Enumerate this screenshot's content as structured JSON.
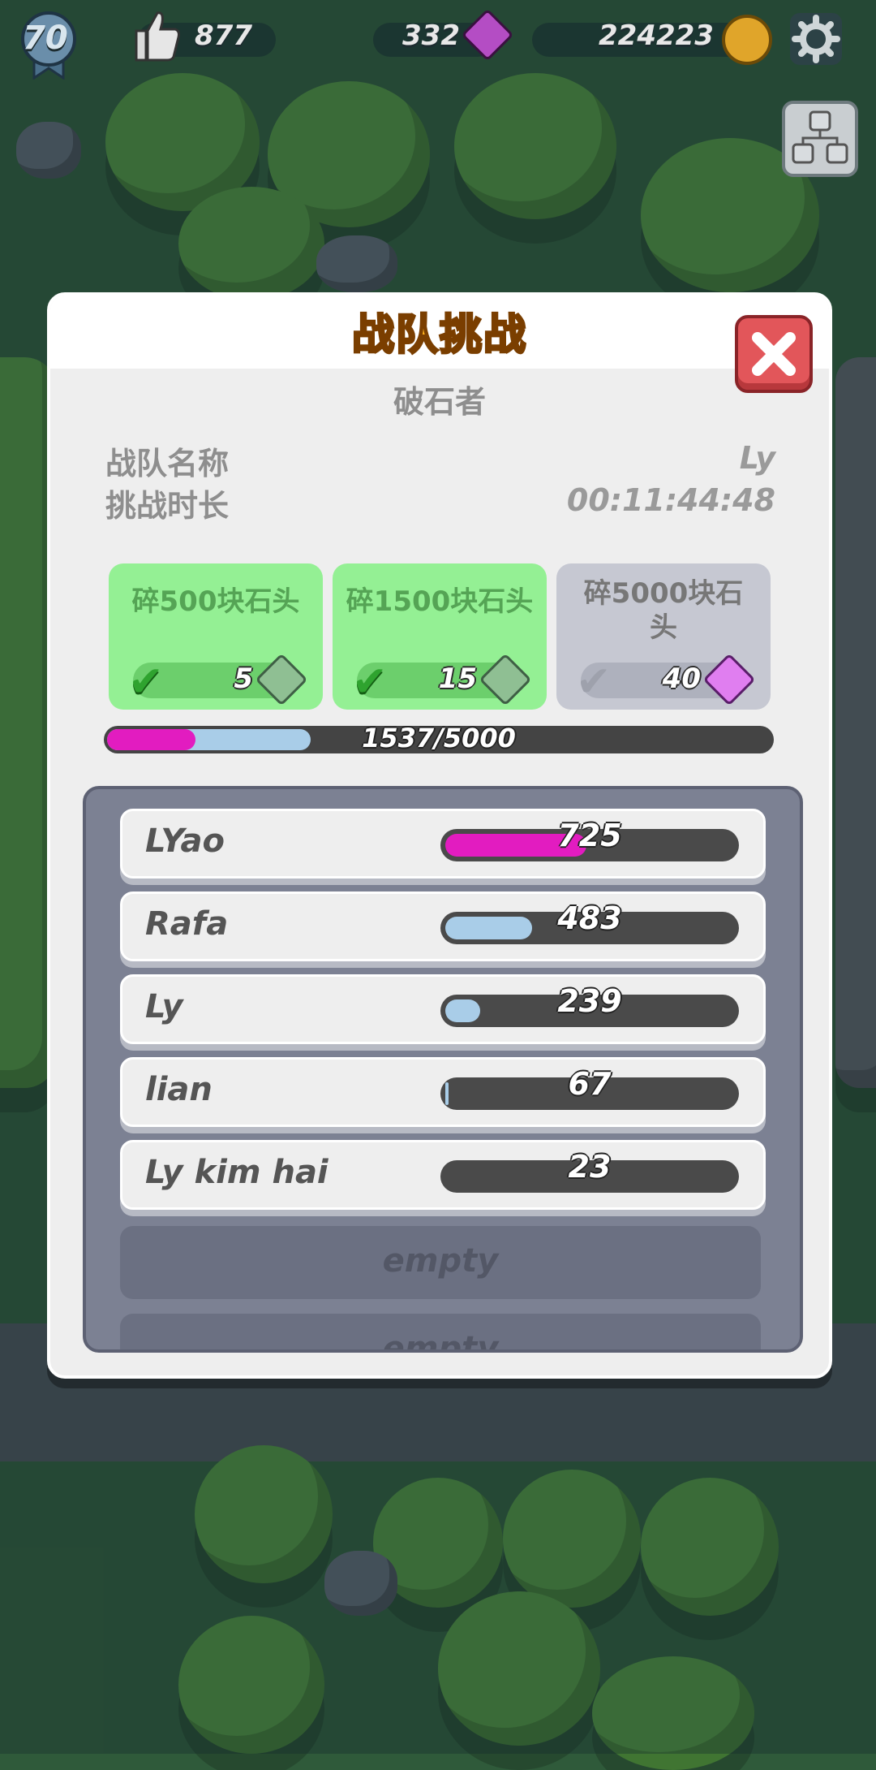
{
  "hud": {
    "level": "70",
    "likes": "877",
    "gems": "332",
    "coins": "224223"
  },
  "dialog": {
    "title": "战队挑战",
    "subtitle": "破石者",
    "team_name_label": "战队名称",
    "team_name_value": "Ly",
    "duration_label": "挑战时长",
    "duration_value": "00:11:44:48",
    "milestones": [
      {
        "title": "碎500块石头",
        "reward": "5",
        "gem": "green-gem-icon",
        "done": true
      },
      {
        "title": "碎1500块石头",
        "reward": "15",
        "gem": "green-gem-icon",
        "done": true
      },
      {
        "title": "碎5000块石头",
        "reward": "40",
        "gem": "purple-gem-icon",
        "done": false
      }
    ],
    "progress_text": "1537/5000",
    "progress": {
      "current": 1537,
      "total": 5000,
      "own": 239,
      "own_of_total_bar_fraction": 0.133
    },
    "members": [
      {
        "name": "LYao",
        "score": "725",
        "fill_fraction": 0.49,
        "color": "#e21cc0"
      },
      {
        "name": "Rafa",
        "score": "483",
        "fill_fraction": 0.3,
        "color": "#a9cde8"
      },
      {
        "name": "Ly",
        "score": "239",
        "fill_fraction": 0.12,
        "color": "#a9cde8"
      },
      {
        "name": "lian",
        "score": "67",
        "fill_fraction": 0.01,
        "color": "#a9cde8"
      },
      {
        "name": "Ly kim hai",
        "score": "23",
        "fill_fraction": 0.0,
        "color": "#a9cde8"
      }
    ],
    "empty_slots": [
      "empty",
      "empty"
    ]
  },
  "colors": {
    "title": "#ffb21e",
    "done_card": "#94f094",
    "todo_card": "#c6c8d2",
    "close": "#e2565a",
    "own_progress": "#e21cc0",
    "team_progress": "#a9cde8"
  }
}
